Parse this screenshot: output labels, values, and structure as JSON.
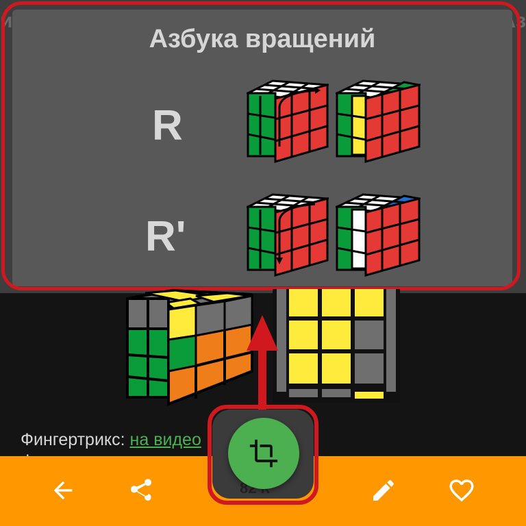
{
  "background_text": {
    "left": "ий",
    "right": "Аз"
  },
  "panel": {
    "title": "Азбука вращений",
    "rows": [
      {
        "label": "R"
      },
      {
        "label": "R'"
      }
    ]
  },
  "caption": {
    "prefix": "Фингертрикс: ",
    "link": "на видео",
    "second_line_partial": "ф"
  },
  "bottom_bar": {
    "notch_text": "82 К",
    "buttons": [
      {
        "name": "back",
        "icon": "arrow-left-icon"
      },
      {
        "name": "share",
        "icon": "share-icon"
      },
      {
        "name": "crop",
        "icon": "crop-icon"
      },
      {
        "name": "edit",
        "icon": "pencil-icon"
      },
      {
        "name": "favorite",
        "icon": "heart-outline-icon"
      }
    ]
  },
  "colors": {
    "accent_orange": "#ff9800",
    "fab_green": "#4caf50",
    "highlight_red": "#d0181e",
    "panel_gray": "#585858",
    "link_green": "#4caf50"
  }
}
